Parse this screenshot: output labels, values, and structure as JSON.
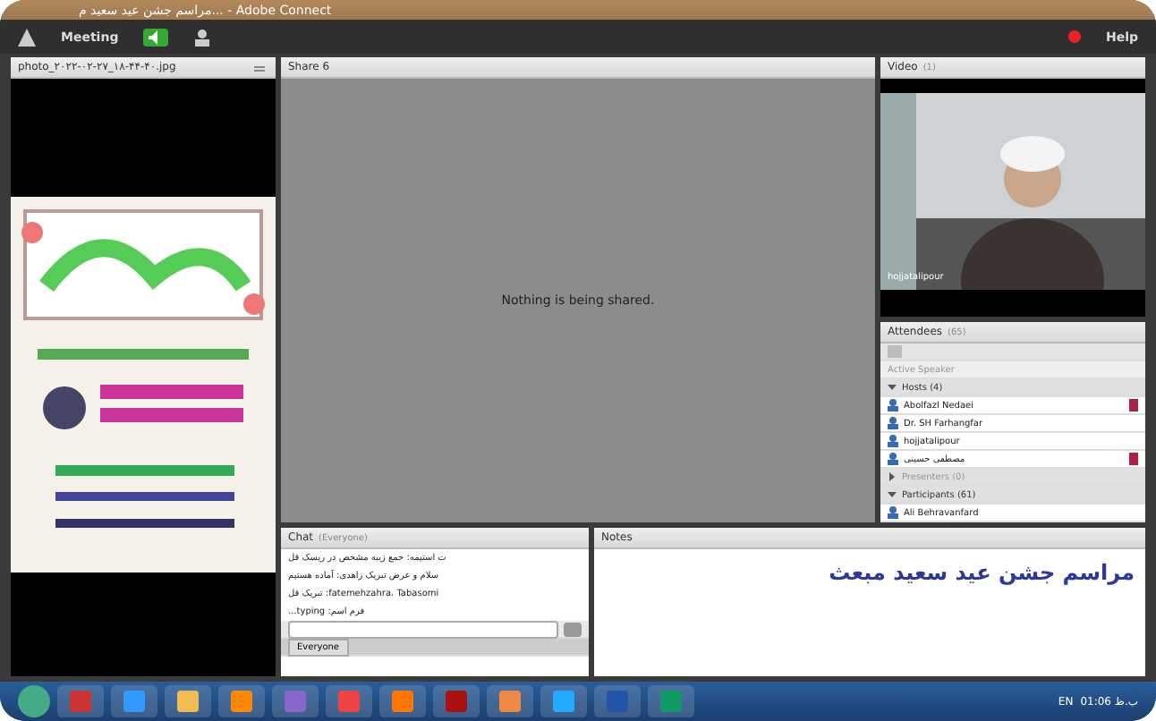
{
  "window": {
    "title": "مراسم جشن عید سعید م... - Adobe Connect"
  },
  "menu": {
    "items": [
      "Meeting"
    ],
    "help": "Help"
  },
  "photo_pod": {
    "title": "photo_۲۰۲۲-۰۲-۲۷_۱۸-۴۴-۴۰.jpg"
  },
  "share_pod": {
    "title": "Share 6",
    "message": "Nothing is being shared."
  },
  "video_pod": {
    "title": "Video",
    "count": "(1)",
    "speaker": "hojjatalipour"
  },
  "attendees": {
    "title": "Attendees",
    "count": "(65)",
    "active_speaker": "Active Speaker",
    "groups": [
      {
        "label": "Hosts (4)",
        "expanded": true,
        "children": [
          {
            "name": "Abolfazl Nedaei",
            "editing": true
          },
          {
            "name": "Dr. SH Farhangfar",
            "editing": false
          },
          {
            "name": "hojjatalipour",
            "editing": false
          },
          {
            "name": "مصطفی حسینی",
            "editing": true
          }
        ]
      },
      {
        "label": "Presenters (0)",
        "expanded": false
      },
      {
        "label": "Participants (61)",
        "expanded": true,
        "children": [
          {
            "name": "Ali Behravanfard",
            "editing": false
          }
        ]
      }
    ]
  },
  "chat": {
    "title": "Chat",
    "scope": "(Everyone)",
    "messages": [
      "ت استیمه: جمع زیبه مشخص در ریسک قل",
      "سلام و عرض تبریک زاهدی: آماده هستیم",
      "fatemehzahra. Tabasomi: تبریک قل",
      "فرم اسم: typing..."
    ],
    "tab": "Everyone"
  },
  "notes": {
    "title": "Notes",
    "text": "مراسم جشن عید سعید مبعث"
  },
  "taskbar": {
    "language": "EN",
    "clock": "01:06 ب.ظ"
  }
}
